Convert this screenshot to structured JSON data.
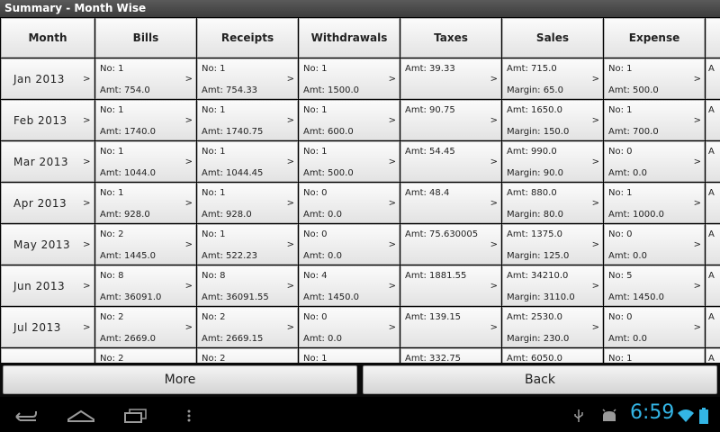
{
  "title": "Summary - Month Wise",
  "columns": [
    "Month",
    "Bills",
    "Receipts",
    "Withdrawals",
    "Taxes",
    "Sales",
    "Expense"
  ],
  "rows": [
    {
      "month": "Jan 2013",
      "bills": [
        "No: 1",
        "Amt: 754.0"
      ],
      "receipts": [
        "No: 1",
        "Amt: 754.33"
      ],
      "withdrawals": [
        "No: 1",
        "Amt: 1500.0"
      ],
      "taxes": [
        "Amt: 39.33",
        ""
      ],
      "sales": [
        "Amt: 715.0",
        "Margin: 65.0"
      ],
      "expense": [
        "No: 1",
        "Amt: 500.0"
      ]
    },
    {
      "month": "Feb 2013",
      "bills": [
        "No: 1",
        "Amt: 1740.0"
      ],
      "receipts": [
        "No: 1",
        "Amt: 1740.75"
      ],
      "withdrawals": [
        "No: 1",
        "Amt: 600.0"
      ],
      "taxes": [
        "Amt: 90.75",
        ""
      ],
      "sales": [
        "Amt: 1650.0",
        "Margin: 150.0"
      ],
      "expense": [
        "No: 1",
        "Amt: 700.0"
      ]
    },
    {
      "month": "Mar 2013",
      "bills": [
        "No: 1",
        "Amt: 1044.0"
      ],
      "receipts": [
        "No: 1",
        "Amt: 1044.45"
      ],
      "withdrawals": [
        "No: 1",
        "Amt: 500.0"
      ],
      "taxes": [
        "Amt: 54.45",
        ""
      ],
      "sales": [
        "Amt: 990.0",
        "Margin: 90.0"
      ],
      "expense": [
        "No: 0",
        "Amt: 0.0"
      ]
    },
    {
      "month": "Apr 2013",
      "bills": [
        "No: 1",
        "Amt: 928.0"
      ],
      "receipts": [
        "No: 1",
        "Amt: 928.0"
      ],
      "withdrawals": [
        "No: 0",
        "Amt: 0.0"
      ],
      "taxes": [
        "Amt: 48.4",
        ""
      ],
      "sales": [
        "Amt: 880.0",
        "Margin: 80.0"
      ],
      "expense": [
        "No: 1",
        "Amt: 1000.0"
      ]
    },
    {
      "month": "May 2013",
      "bills": [
        "No: 2",
        "Amt: 1445.0"
      ],
      "receipts": [
        "No: 1",
        "Amt: 522.23"
      ],
      "withdrawals": [
        "No: 0",
        "Amt: 0.0"
      ],
      "taxes": [
        "Amt: 75.630005",
        ""
      ],
      "sales": [
        "Amt: 1375.0",
        "Margin: 125.0"
      ],
      "expense": [
        "No: 0",
        "Amt: 0.0"
      ]
    },
    {
      "month": "Jun 2013",
      "bills": [
        "No: 8",
        "Amt: 36091.0"
      ],
      "receipts": [
        "No: 8",
        "Amt: 36091.55"
      ],
      "withdrawals": [
        "No: 4",
        "Amt: 1450.0"
      ],
      "taxes": [
        "Amt: 1881.55",
        ""
      ],
      "sales": [
        "Amt: 34210.0",
        "Margin: 3110.0"
      ],
      "expense": [
        "No: 5",
        "Amt: 1450.0"
      ]
    },
    {
      "month": "Jul 2013",
      "bills": [
        "No: 2",
        "Amt: 2669.0"
      ],
      "receipts": [
        "No: 2",
        "Amt: 2669.15"
      ],
      "withdrawals": [
        "No: 0",
        "Amt: 0.0"
      ],
      "taxes": [
        "Amt: 139.15",
        ""
      ],
      "sales": [
        "Amt: 2530.0",
        "Margin: 230.0"
      ],
      "expense": [
        "No: 0",
        "Amt: 0.0"
      ]
    },
    {
      "month": "",
      "bills": [
        "No: 2",
        ""
      ],
      "receipts": [
        "No: 2",
        ""
      ],
      "withdrawals": [
        "No: 1",
        ""
      ],
      "taxes": [
        "Amt: 332.75",
        ""
      ],
      "sales": [
        "Amt: 6050.0",
        ""
      ],
      "expense": [
        "No: 1",
        ""
      ]
    }
  ],
  "partial_column_label": "A",
  "arrow": ">",
  "buttons": {
    "more": "More",
    "back": "Back"
  },
  "status": {
    "clock": "6:59"
  }
}
